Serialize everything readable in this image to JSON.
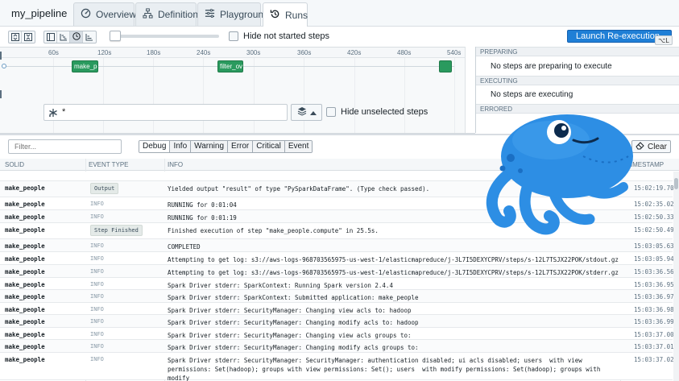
{
  "pipeline_name": "my_pipeline",
  "tabs": [
    {
      "label": "Overview",
      "icon": "overview-icon"
    },
    {
      "label": "Definition",
      "icon": "definition-icon"
    },
    {
      "label": "Playground",
      "icon": "playground-icon"
    },
    {
      "label": "Runs",
      "icon": "runs-icon",
      "active": true
    }
  ],
  "toolbar": {
    "hide_not_started_label": "Hide not started steps",
    "launch_label": "Launch Re-execution",
    "launch_shortcut": "⌥L",
    "slider_value": 0.08
  },
  "gantt": {
    "ticks": [
      "60s",
      "120s",
      "180s",
      "240s",
      "300s",
      "360s",
      "420s",
      "480s",
      "540s"
    ],
    "bars": [
      {
        "label": "make_pe"
      },
      {
        "label": "filter_ove"
      },
      {
        "label": ""
      }
    ],
    "filter_value": "*",
    "hide_unselected_label": "Hide unselected steps"
  },
  "panel": {
    "preparing_header": "PREPARING",
    "preparing_text": "No steps are preparing to execute",
    "executing_header": "EXECUTING",
    "executing_text": "No steps are executing",
    "errored_header": "ERRORED"
  },
  "logs": {
    "filter_placeholder": "Filter...",
    "levels": [
      "Debug",
      "Info",
      "Warning",
      "Error",
      "Critical",
      "Event"
    ],
    "clear_label": "Clear",
    "columns": {
      "solid": "SOLID",
      "event_type": "EVENT TYPE",
      "info": "INFO",
      "timestamp": "TIMESTAMP"
    },
    "rows": [
      {
        "solid": "",
        "type": "",
        "info": "",
        "ts": ""
      },
      {
        "solid": "make_people",
        "type": "Output",
        "tag": true,
        "info": "Yielded output \"result\" of type \"PySparkDataFrame\". (Type check passed).",
        "ts": "15:02:19.70"
      },
      {
        "solid": "make_people",
        "type": "INFO",
        "info": "RUNNING for 0:01:04",
        "ts": "15:02:35.02"
      },
      {
        "solid": "make_people",
        "type": "INFO",
        "info": "RUNNING for 0:01:19",
        "ts": "15:02:50.33"
      },
      {
        "solid": "make_people",
        "type": "Step Finished",
        "tag": true,
        "info": "Finished execution of step \"make_people.compute\" in 25.5s.",
        "ts": "15:02:50.49"
      },
      {
        "solid": "make_people",
        "type": "INFO",
        "info": "COMPLETED",
        "ts": "15:03:05.63"
      },
      {
        "solid": "make_people",
        "type": "INFO",
        "info": "Attempting to get log: s3://aws-logs-968703565975-us-west-1/elasticmapreduce/j-3L7I5DEXYCPRV/steps/s-12L7TSJX22POK/stdout.gz",
        "ts": "15:03:05.94"
      },
      {
        "solid": "make_people",
        "type": "INFO",
        "info": "Attempting to get log: s3://aws-logs-968703565975-us-west-1/elasticmapreduce/j-3L7I5DEXYCPRV/steps/s-12L7TSJX22POK/stderr.gz",
        "ts": "15:03:36.56"
      },
      {
        "solid": "make_people",
        "type": "INFO",
        "info": "Spark Driver stderr: SparkContext: Running Spark version 2.4.4",
        "ts": "15:03:36.95"
      },
      {
        "solid": "make_people",
        "type": "INFO",
        "info": "Spark Driver stderr: SparkContext: Submitted application: make_people",
        "ts": "15:03:36.97"
      },
      {
        "solid": "make_people",
        "type": "INFO",
        "info": "Spark Driver stderr: SecurityManager: Changing view acls to: hadoop",
        "ts": "15:03:36.98"
      },
      {
        "solid": "make_people",
        "type": "INFO",
        "info": "Spark Driver stderr: SecurityManager: Changing modify acls to: hadoop",
        "ts": "15:03:36.99"
      },
      {
        "solid": "make_people",
        "type": "INFO",
        "info": "Spark Driver stderr: SecurityManager: Changing view acls groups to:",
        "ts": "15:03:37.00"
      },
      {
        "solid": "make_people",
        "type": "INFO",
        "info": "Spark Driver stderr: SecurityManager: Changing modify acls groups to:",
        "ts": "15:03:37.01"
      },
      {
        "solid": "make_people",
        "type": "INFO",
        "info": "Spark Driver stderr: SecurityManager: SecurityManager: authentication disabled; ui acls disabled; users  with view\npermissions: Set(hadoop); groups with view permissions: Set(); users  with modify permissions: Set(hadoop); groups with modify\npermissions: Set()",
        "ts": "15:03:37.02"
      }
    ]
  },
  "colors": {
    "accent": "#137cbd",
    "success": "#2a9a5e",
    "mascot": "#2d8ee4"
  }
}
